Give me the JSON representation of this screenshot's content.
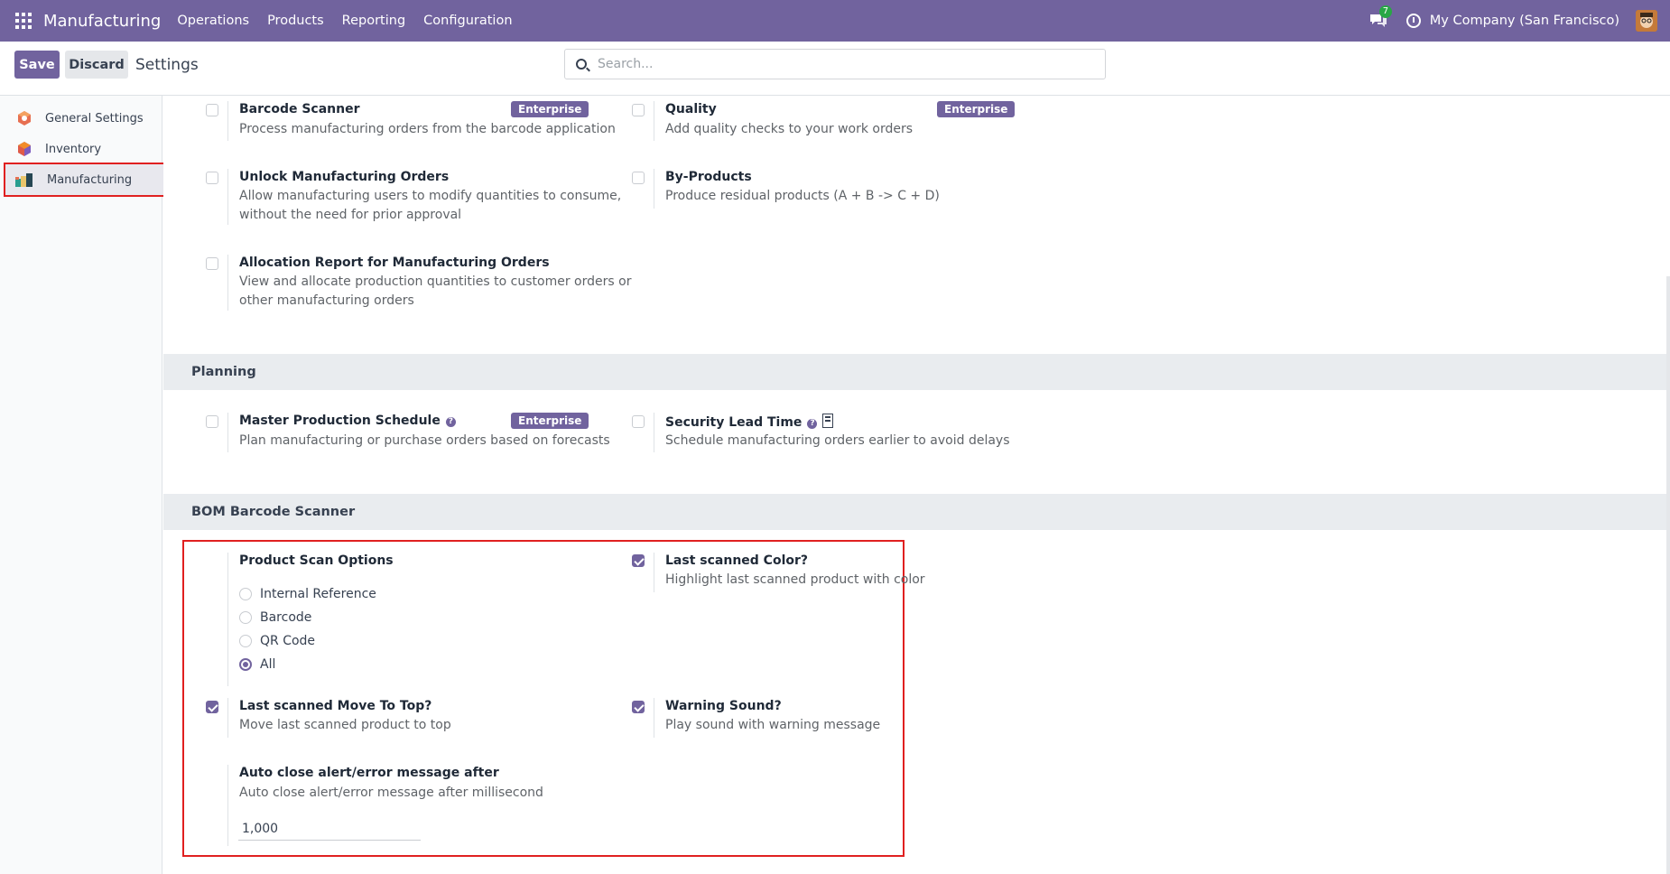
{
  "navbar": {
    "brand": "Manufacturing",
    "menu": [
      "Operations",
      "Products",
      "Reporting",
      "Configuration"
    ],
    "chat_count": "7",
    "company": "My Company (San Francisco)"
  },
  "control": {
    "save_label": "Save",
    "discard_label": "Discard",
    "title": "Settings",
    "search_placeholder": "Search..."
  },
  "sidebar": {
    "items": [
      {
        "label": "General Settings"
      },
      {
        "label": "Inventory"
      },
      {
        "label": "Manufacturing"
      }
    ]
  },
  "settings": {
    "barcode": {
      "title": "Barcode Scanner",
      "desc": "Process manufacturing orders from the barcode application",
      "badge": "Enterprise"
    },
    "quality": {
      "title": "Quality",
      "desc": "Add quality checks to your work orders",
      "badge": "Enterprise"
    },
    "unlock": {
      "title": "Unlock Manufacturing Orders",
      "desc1": "Allow manufacturing users to modify quantities to consume,",
      "desc2": "without the need for prior approval"
    },
    "byproducts": {
      "title": "By-Products",
      "desc": "Produce residual products (A + B -> C + D)"
    },
    "allocation": {
      "title": "Allocation Report for Manufacturing Orders",
      "desc1": "View and allocate production quantities to customer orders or",
      "desc2": "other manufacturing orders"
    }
  },
  "planning": {
    "heading": "Planning",
    "mps": {
      "title": "Master Production Schedule",
      "desc": "Plan manufacturing or purchase orders based on forecasts",
      "badge": "Enterprise"
    },
    "security": {
      "title": "Security Lead Time",
      "desc": "Schedule manufacturing orders earlier to avoid delays"
    }
  },
  "bom": {
    "heading": "BOM Barcode Scanner",
    "scan_options": {
      "title": "Product Scan Options",
      "options": [
        "Internal Reference",
        "Barcode",
        "QR Code",
        "All"
      ],
      "selected": "All"
    },
    "last_color": {
      "title": "Last scanned Color?",
      "desc": "Highlight last scanned product with color",
      "checked": true
    },
    "move_top": {
      "title": "Last scanned Move To Top?",
      "desc": "Move last scanned product to top",
      "checked": true
    },
    "warning": {
      "title": "Warning Sound?",
      "desc": "Play sound with warning message",
      "checked": true
    },
    "auto_close": {
      "title": "Auto close alert/error message after",
      "desc": "Auto close alert/error message after millisecond",
      "value": "1,000"
    }
  }
}
